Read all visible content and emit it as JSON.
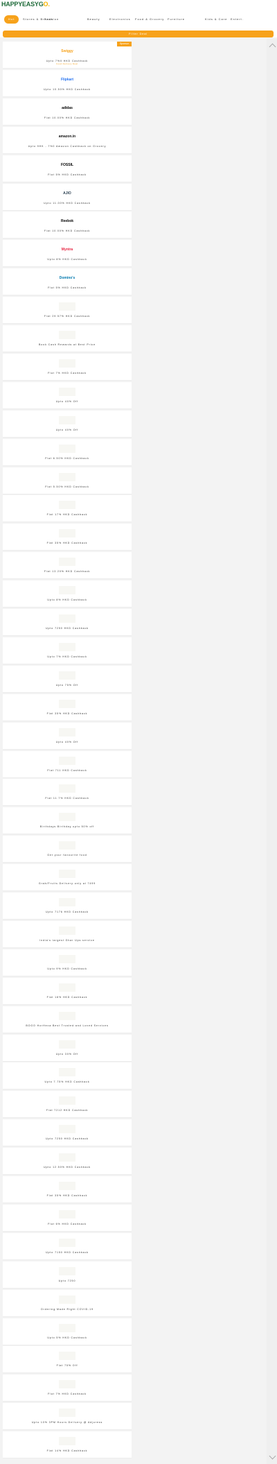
{
  "header": {
    "logo_main": "HAPPYEASYG",
    "logo_accent": "O."
  },
  "categories": [
    "Hot",
    "Stores & Brands",
    "Fashion",
    "Beauty",
    "Electronics",
    "Food & Grocery",
    "Furniture",
    "Kids & Care",
    "Entert."
  ],
  "filter_label": "Filter Deal",
  "cards": [
    {
      "brand": "Swiggy",
      "offer": "Upto 7%0 HKD Cashback",
      "sub": "Food Delivery Deal",
      "badge": "Sponsor",
      "brand_color": "#f7a21b"
    },
    {
      "brand": "Flipkart",
      "offer": "Upto 10.50% HKD Cashback",
      "brand_color": "#2874f0"
    },
    {
      "brand": "adidas",
      "offer": "Flat 10.00% HKD Cashback",
      "brand_color": "#000000"
    },
    {
      "brand": "amazon.in",
      "offer": "Upto 9HK - 7%0 Amazon Cashback on Grocery",
      "brand_color": "#111111"
    },
    {
      "brand": "FOSSIL",
      "offer": "Flat 5% HKD Cashback",
      "brand_color": "#000000"
    },
    {
      "brand": "AJIO",
      "offer": "Upto 11.00% HKD Cashback",
      "brand_color": "#2c4152"
    },
    {
      "brand": "Reebok",
      "offer": "Flat 10.00% HKD Cashback",
      "brand_color": "#000000"
    },
    {
      "brand": "Myntra",
      "offer": "Upto 8% HKD Cashback",
      "brand_color": "#e72744"
    },
    {
      "brand": "Domino's",
      "offer": "Flat 5% HKD Cashback",
      "brand_color": "#0078ae"
    },
    {
      "offer": "Flat 29.57% HKD Cashback"
    },
    {
      "offer": "Book Cash Rewards at Best Price"
    },
    {
      "offer": "Flat 7% HKD Cashback"
    },
    {
      "offer": "Upto 40% Off"
    },
    {
      "offer": "Upto 40% Off"
    },
    {
      "offer": "Flat 6.50% HKD Cashback"
    },
    {
      "offer": "Flat 5.50% HKD Cashback"
    },
    {
      "offer": "Flat 17% HKD Cashback"
    },
    {
      "offer": "Flat 35% HKD Cashback"
    },
    {
      "offer": "Flat 13.20% HKD Cashback"
    },
    {
      "offer": "Upto 8% HKD Cashback"
    },
    {
      "offer": "Upto 7250 HKD Cashback"
    },
    {
      "offer": "Upto 7% HKD Cashback"
    },
    {
      "offer": "Upto 75% Off"
    },
    {
      "offer": "Flat 35% HKD Cashback"
    },
    {
      "offer": "Upto 40% Off"
    },
    {
      "offer": "Flat 711 HKD Cashback"
    },
    {
      "offer": "Flat 11.7% HKD Cashback"
    },
    {
      "offer": "Birthdays Birthday upto 50% off"
    },
    {
      "offer": "Get your favourite food"
    },
    {
      "offer": "Grab/Fruits Delivery only at 7499"
    },
    {
      "offer": "Upto 7176 HKD Cashback"
    },
    {
      "offer": "India's largest Ghar Ups service"
    },
    {
      "offer": "Upto 9% HKD Cashback"
    },
    {
      "offer": "Flat 18% HKD Cashback"
    },
    {
      "offer": "BOGO HorHexa Best Trusted and Loved Services"
    },
    {
      "offer": "Upto 30% Off"
    },
    {
      "offer": "Upto 7.75% HKD Cashback"
    },
    {
      "offer": "Flat 7212 HKD Cashback"
    },
    {
      "offer": "Upto 7250 HKD Cashback"
    },
    {
      "offer": "Upto 12.50% HKD Cashback"
    },
    {
      "offer": "Flat 35% HKD Cashback"
    },
    {
      "offer": "Flat 6% HKD Cashback"
    },
    {
      "offer": "Upto 7150 HKD Cashback"
    },
    {
      "offer": "Upto 7250"
    },
    {
      "offer": "Ordering Made Right COVID-19"
    },
    {
      "offer": "Upto 5% HKD Cashback"
    },
    {
      "offer": "Flat 75% Off"
    },
    {
      "offer": "Flat 7% HKD Cashback"
    },
    {
      "offer": "Upto 10% 3PM Hours Delivery @ Adjuress"
    },
    {
      "offer": "Flat 14% HKD Cashback"
    }
  ]
}
